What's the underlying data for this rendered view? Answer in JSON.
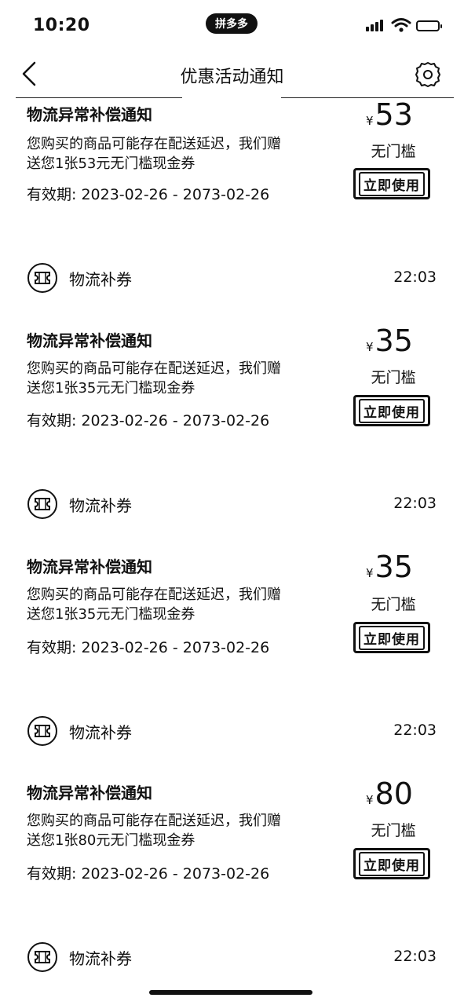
{
  "status": {
    "time": "10:20",
    "app_badge": "拼多多"
  },
  "nav": {
    "title": "优惠活动通知"
  },
  "coupons": [
    {
      "title": "物流异常补偿通知",
      "desc_line1": "您购买的商品可能存在配送延迟，我们赠",
      "desc_line2": "送您1张53元无门槛现金券",
      "validity": "有效期: 2023-02-26 - 2073-02-26",
      "currency": "¥",
      "amount": "53",
      "threshold": "无门槛",
      "action": "立即使用"
    },
    {
      "title": "物流异常补偿通知",
      "desc_line1": "您购买的商品可能存在配送延迟，我们赠",
      "desc_line2": "送您1张35元无门槛现金券",
      "validity": "有效期: 2023-02-26 - 2073-02-26",
      "currency": "¥",
      "amount": "35",
      "threshold": "无门槛",
      "action": "立即使用"
    },
    {
      "title": "物流异常补偿通知",
      "desc_line1": "您购买的商品可能存在配送延迟，我们赠",
      "desc_line2": "送您1张35元无门槛现金券",
      "validity": "有效期: 2023-02-26 - 2073-02-26",
      "currency": "¥",
      "amount": "35",
      "threshold": "无门槛",
      "action": "立即使用"
    },
    {
      "title": "物流异常补偿通知",
      "desc_line1": "您购买的商品可能存在配送延迟，我们赠",
      "desc_line2": "送您1张80元无门槛现金券",
      "validity": "有效期: 2023-02-26 - 2073-02-26",
      "currency": "¥",
      "amount": "80",
      "threshold": "无门槛",
      "action": "立即使用"
    }
  ],
  "sections": [
    {
      "label": "物流补券",
      "time": "22:03",
      "icon": "ticket-icon"
    },
    {
      "label": "物流补券",
      "time": "22:03",
      "icon": "ticket-icon"
    },
    {
      "label": "物流补券",
      "time": "22:03",
      "icon": "ticket-icon"
    },
    {
      "label": "物流补券",
      "time": "22:03",
      "icon": "ticket-icon"
    }
  ]
}
